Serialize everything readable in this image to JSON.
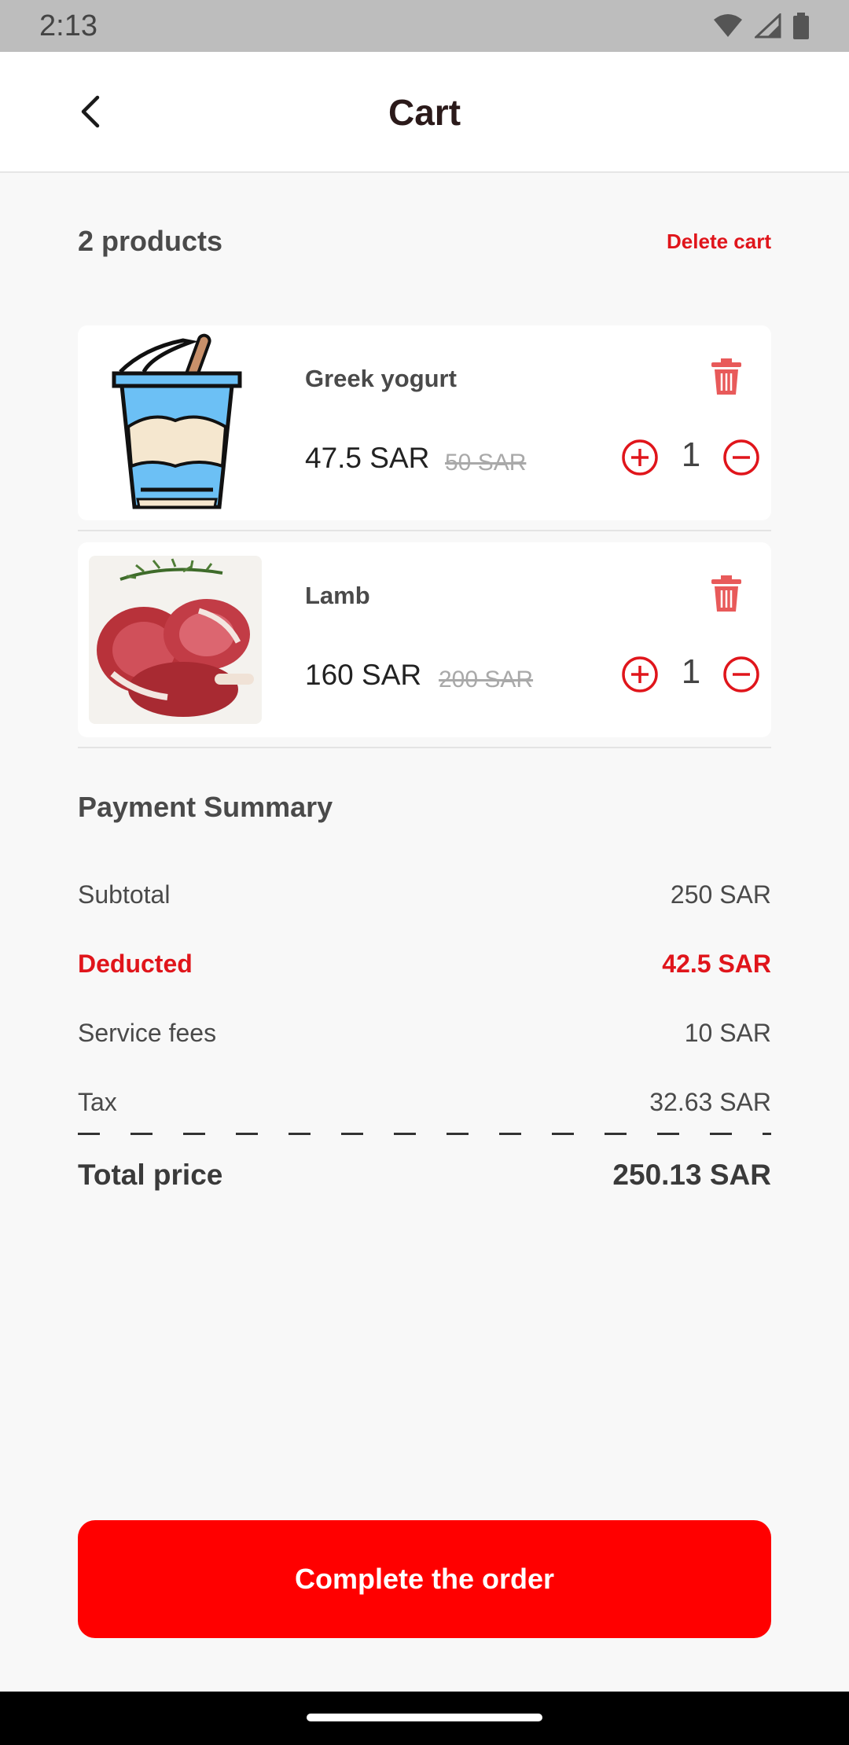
{
  "status_bar": {
    "time": "2:13",
    "icons": [
      "wifi-icon",
      "signal-icon",
      "battery-icon"
    ]
  },
  "header": {
    "title": "Cart",
    "back_icon": "chevron-left-icon"
  },
  "cart": {
    "count_label": "2 products",
    "delete_label": "Delete cart",
    "items": [
      {
        "name": "Greek yogurt",
        "price": "47.5 SAR",
        "old_price": "50 SAR",
        "qty": "1",
        "image": "yogurt-cup-image"
      },
      {
        "name": "Lamb",
        "price": "160 SAR",
        "old_price": "200 SAR",
        "qty": "1",
        "image": "lamb-chops-photo"
      }
    ]
  },
  "summary": {
    "title": "Payment Summary",
    "rows": [
      {
        "label": "Subtotal",
        "value": "250 SAR"
      },
      {
        "label": "Deducted",
        "value": "42.5 SAR"
      },
      {
        "label": "Service fees",
        "value": "10 SAR"
      },
      {
        "label": "Tax",
        "value": "32.63 SAR"
      }
    ],
    "total_label": "Total price",
    "total_value": "250.13 SAR"
  },
  "actions": {
    "complete_label": "Complete the order"
  },
  "colors": {
    "accent": "#ff0000",
    "deducted": "#e0151b",
    "background": "#f8f8f8"
  }
}
